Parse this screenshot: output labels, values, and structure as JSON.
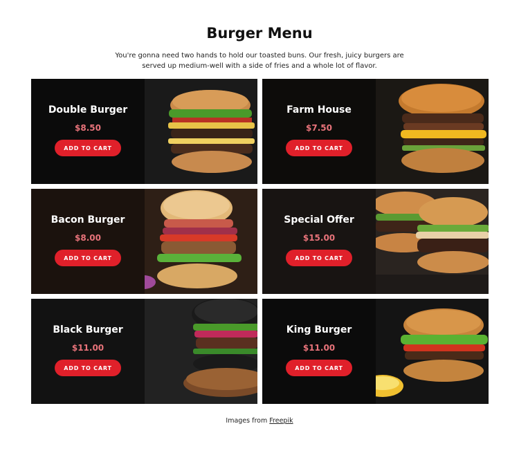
{
  "page": {
    "title": "Burger Menu",
    "intro": "You're gonna need two hands to hold our toasted buns. Our fresh, juicy burgers are served up medium-well with a side of fries and a whole lot of flavor."
  },
  "cards": [
    {
      "name": "Double Burger",
      "price": "$8.50",
      "button": "ADD TO CART"
    },
    {
      "name": "Farm House",
      "price": "$7.50",
      "button": "ADD TO CART"
    },
    {
      "name": "Bacon Burger",
      "price": "$8.00",
      "button": "ADD TO CART"
    },
    {
      "name": "Special Offer",
      "price": "$15.00",
      "button": "ADD TO CART"
    },
    {
      "name": "Black Burger",
      "price": "$11.00",
      "button": "ADD TO CART"
    },
    {
      "name": "King Burger",
      "price": "$11.00",
      "button": "ADD TO CART"
    }
  ],
  "footer": {
    "prefix": "Images from",
    "link": "Freepik"
  },
  "colors": {
    "button": "#e0202a",
    "price": "#e8737a",
    "card_bg": "#141414"
  }
}
